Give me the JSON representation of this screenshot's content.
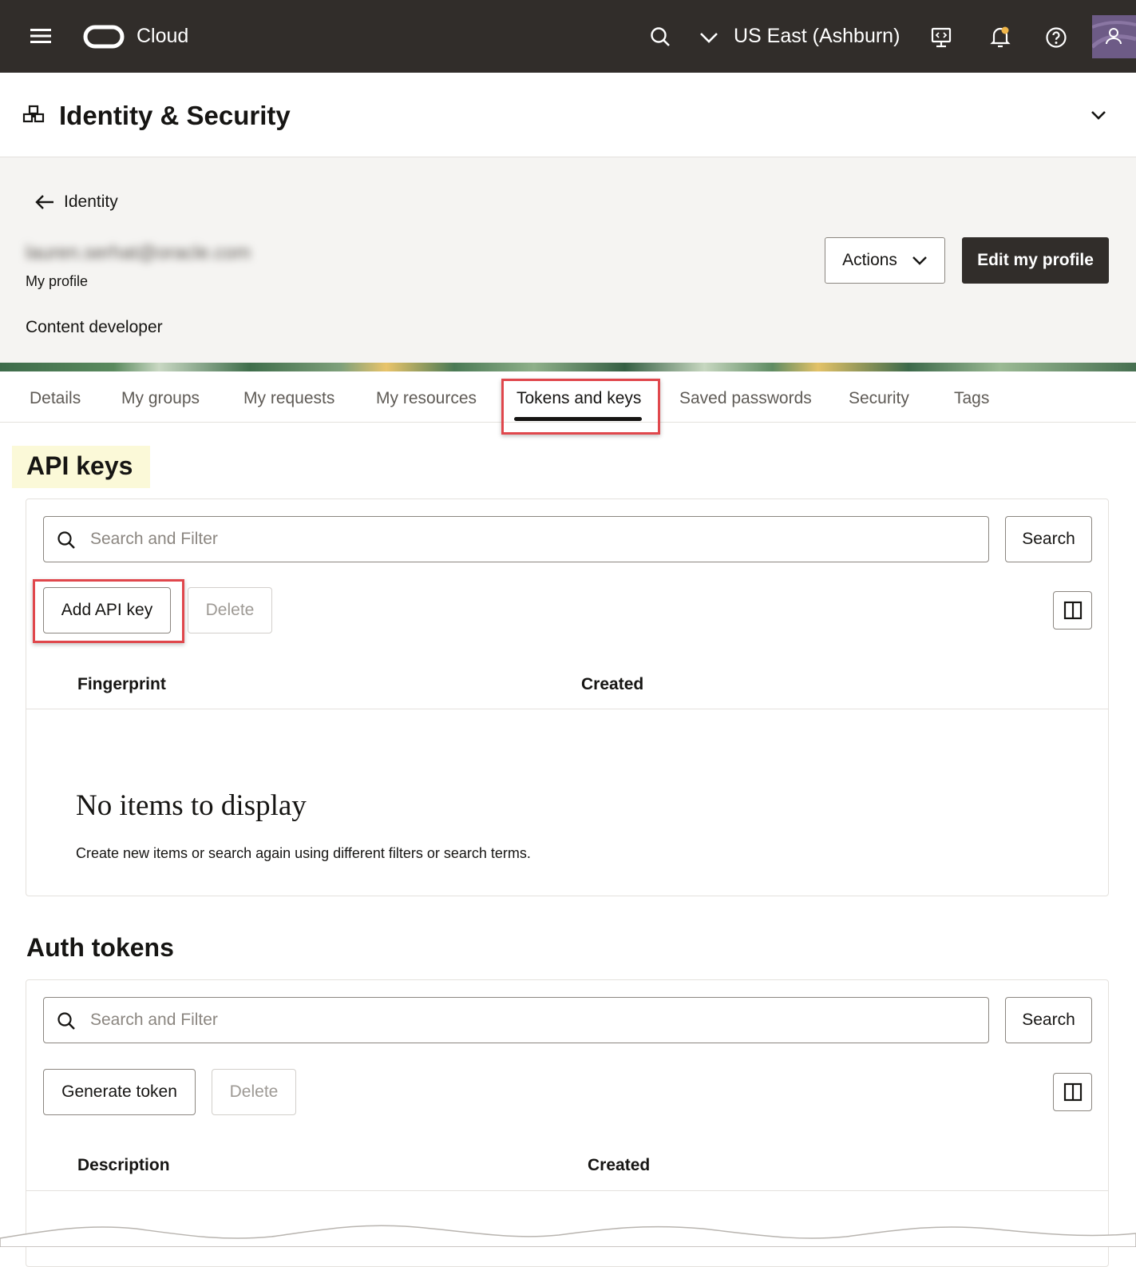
{
  "topbar": {
    "brand": "Cloud",
    "region": "US East (Ashburn)"
  },
  "header": {
    "title": "Identity & Security"
  },
  "profile": {
    "back_label": "Identity",
    "email": "lauren.serhat@oracle.com",
    "subtitle": "My profile",
    "role": "Content developer",
    "actions_label": "Actions",
    "edit_label": "Edit my profile"
  },
  "tabs": [
    "Details",
    "My groups",
    "My requests",
    "My resources",
    "Tokens and keys",
    "Saved passwords",
    "Security",
    "Tags"
  ],
  "api_keys": {
    "title": "API keys",
    "search_placeholder": "Search and Filter",
    "search_label": "Search",
    "add_label": "Add API key",
    "delete_label": "Delete",
    "columns": [
      "Fingerprint",
      "Created"
    ],
    "empty_title": "No items to display",
    "empty_text": "Create new items or search again using different filters or search terms."
  },
  "auth_tokens": {
    "title": "Auth tokens",
    "search_placeholder": "Search and Filter",
    "search_label": "Search",
    "generate_label": "Generate token",
    "delete_label": "Delete",
    "columns": [
      "Description",
      "Created"
    ]
  },
  "colors": {
    "topbar": "#312d2a",
    "highlight": "#e0474c",
    "title_highlight": "#fbf9d8"
  }
}
